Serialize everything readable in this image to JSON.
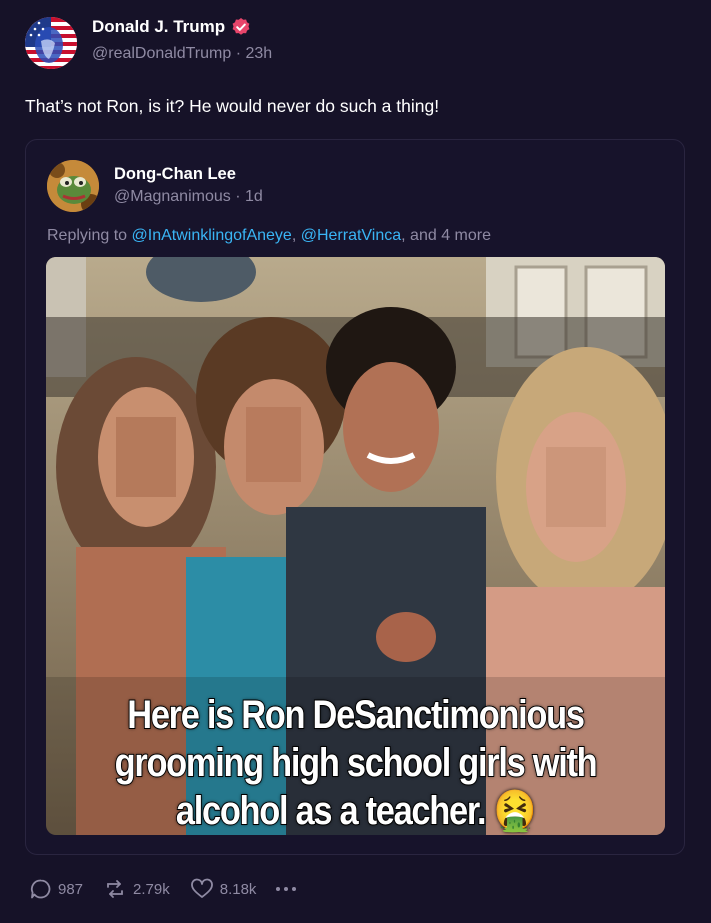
{
  "post": {
    "author_name": "Donald J. Trump",
    "handle_time": "@realDonaldTrump · 23h",
    "text": "That’s not Ron, is it? He would never do such a thing!",
    "avatar_icon": "us-flag-face-avatar",
    "verified_icon": "verified-badge-icon",
    "verified_color": "#e8456b"
  },
  "quote": {
    "author_name": "Dong-Chan Lee",
    "handle_time": "@Magnanimous · 1d",
    "replying_prefix": "Replying to ",
    "mention_1": "@InAtwinklingofAneye",
    "separator": ", ",
    "mention_2": "@HerratVinca",
    "replying_suffix": ", and 4 more",
    "image_caption": "Here is Ron DeSanctimonious grooming high school girls with alcohol as a teacher.",
    "caption_emoji": "🤮",
    "mention_color": "#3ab5f5"
  },
  "actions": {
    "replies": "987",
    "reposts": "2.79k",
    "likes": "8.18k"
  }
}
